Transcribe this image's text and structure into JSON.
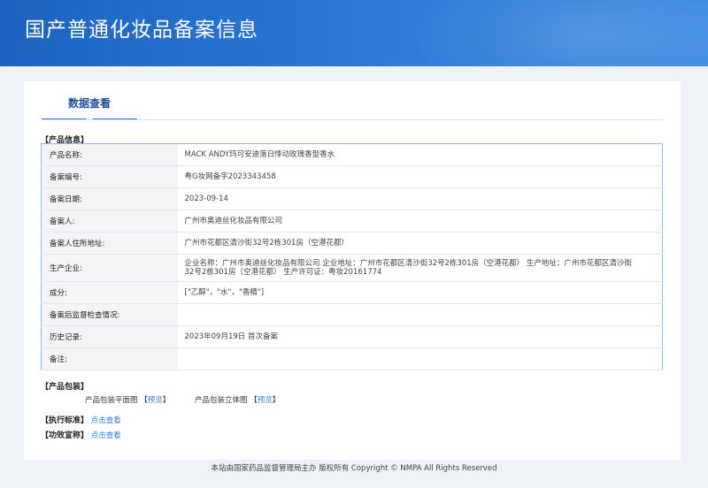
{
  "header": {
    "title": "国产普通化妆品备案信息"
  },
  "tab": {
    "label": "数据查看"
  },
  "product_info": {
    "section_title": "【产品信息】",
    "rows": [
      {
        "label": "产品名称:",
        "value": "MACK ANDY玛可安迪落日悸动玫瑰香型香水"
      },
      {
        "label": "备案编号:",
        "value": "粤G妆网备字2023343458"
      },
      {
        "label": "备案日期:",
        "value": "2023-09-14"
      },
      {
        "label": "备案人:",
        "value": "广州市奥迪丝化妆品有限公司"
      },
      {
        "label": "备案人住所地址:",
        "value": "广州市花都区清沙街32号2栋301房（空港花都）"
      },
      {
        "label": "生产企业:",
        "value": "企业名称：广州市奥迪丝化妆品有限公司 企业地址：广州市花都区清沙街32号2栋301房（空港花都） 生产地址：广州市花都区清沙街32号2栋301房（空港花都） 生产许可证：粤妆20161774"
      },
      {
        "label": "成分:",
        "value": "[\"乙醇\"，\"水\"，\"香精\"]"
      },
      {
        "label": "备案后监督检查情况:",
        "value": ""
      },
      {
        "label": "历史记录:",
        "value": "2023年09月19日 首次备案"
      },
      {
        "label": "备注:",
        "value": ""
      }
    ]
  },
  "packaging": {
    "section_title": "【产品包装】",
    "flat_label": "产品包装平面图",
    "flat_link": "预览",
    "solid_label": "产品包装立体图",
    "solid_link": "预览",
    "bracket_open": "【",
    "bracket_close": "】"
  },
  "standard": {
    "section_title": "【执行标准】",
    "link": "点击查看"
  },
  "efficacy": {
    "section_title": "【功效宣称】",
    "link": "点击查看"
  },
  "footer": {
    "text": "本站由国家药品监督管理局主办 版权所有 Copyright © NMPA All Rights Reserved"
  }
}
